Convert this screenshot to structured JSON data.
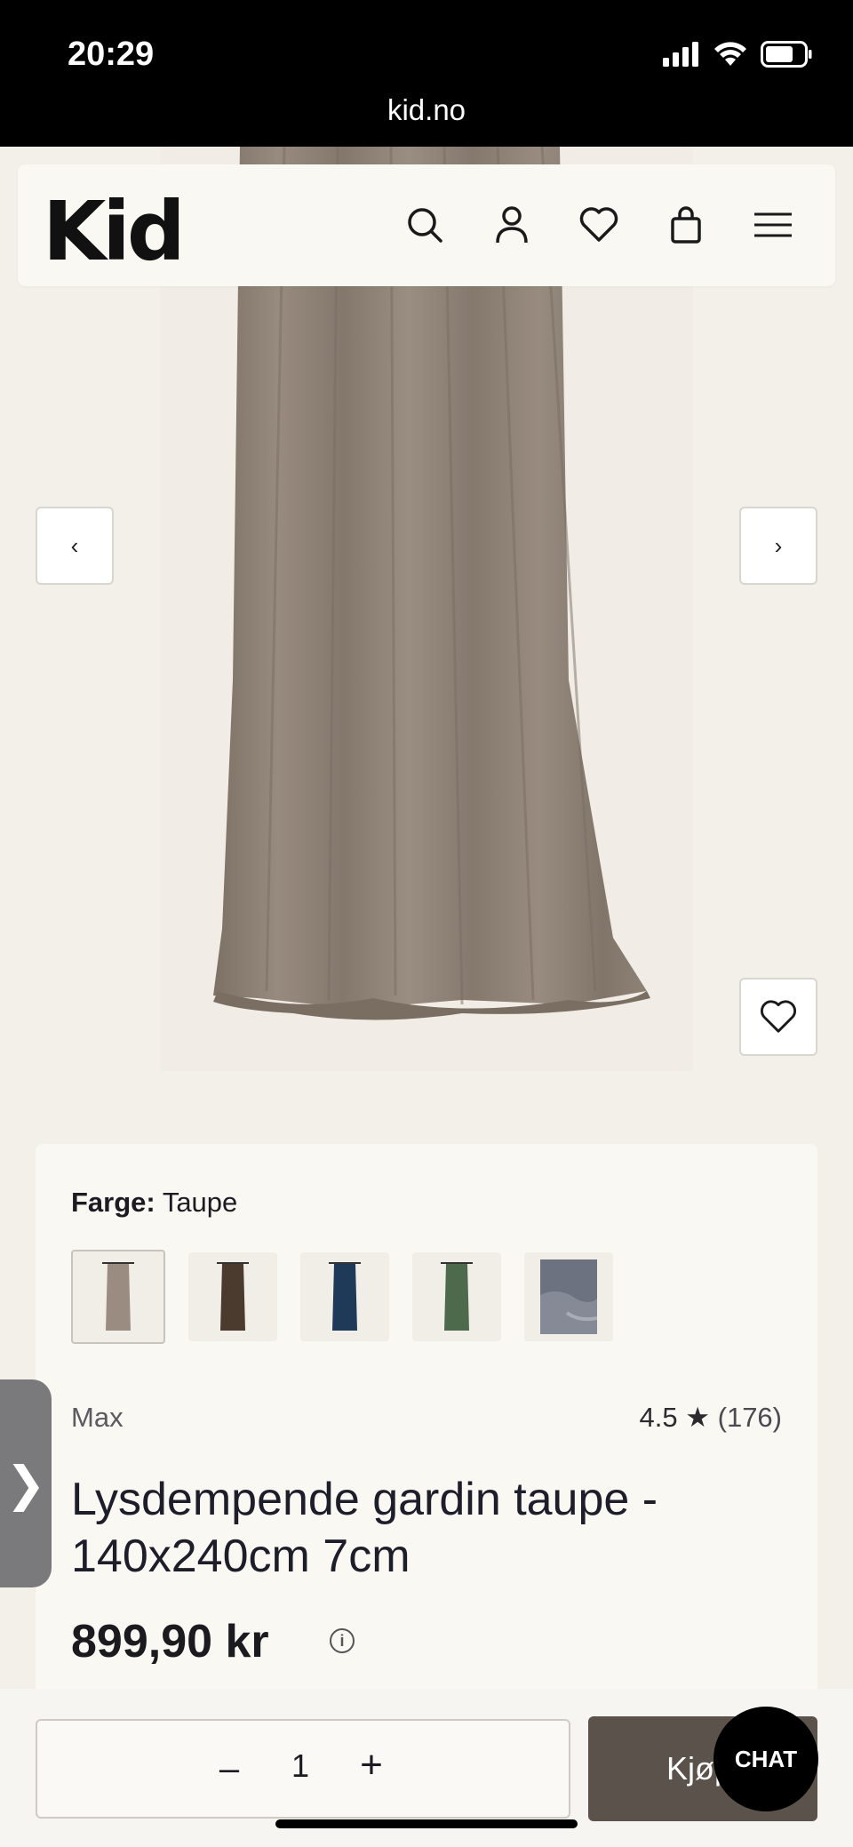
{
  "status_bar": {
    "time": "20:29",
    "url": "kid.no"
  },
  "header": {
    "logo": "Kid",
    "icons": [
      "search-icon",
      "user-icon",
      "heart-icon",
      "bag-icon",
      "menu-icon"
    ]
  },
  "gallery": {
    "prev_label": "‹",
    "next_label": "›"
  },
  "product": {
    "color_label": "Farge:",
    "color_value": "Taupe",
    "swatches": [
      "taupe",
      "brown",
      "navy",
      "green",
      "grey"
    ],
    "brand": "Max",
    "rating_value": "4.5",
    "rating_star": "★",
    "rating_count": "(176)",
    "title": "Lysdempende gardin taupe - 140x240cm 7cm",
    "price": "899,90 kr",
    "info": "i"
  },
  "side_tab": {
    "label": "❯"
  },
  "bottom_bar": {
    "minus": "–",
    "quantity": "1",
    "plus": "+",
    "buy_label": "Kjøp",
    "chat_label": "CHAT"
  },
  "colors": {
    "curtain": "#8f8276",
    "buy_button": "#5a524b",
    "background": "#f3efe9"
  }
}
